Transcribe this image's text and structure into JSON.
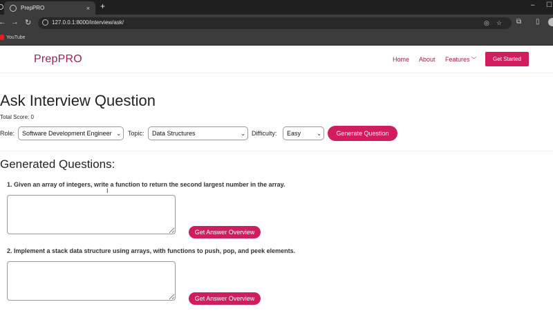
{
  "browser": {
    "tab_title": "PrepPRO",
    "tab_close": "×",
    "new_tab": "+",
    "url": "127.0.0.1:8000/interview/ask/",
    "bookmarks": [
      {
        "label": "YouTube"
      }
    ],
    "window_controls": {
      "minimize": "–",
      "maximize": "☐"
    }
  },
  "header": {
    "brand": "PrepPRO",
    "nav": [
      {
        "label": "Home"
      },
      {
        "label": "About"
      },
      {
        "label": "Features",
        "has_dropdown": true
      }
    ],
    "cta_label": "Get Started"
  },
  "page": {
    "title": "Ask Interview Question",
    "total_score": "Total Score: 0",
    "controls": {
      "role_label": "Role:",
      "role_value": "Software Development Engineer",
      "topic_label": "Topic:",
      "topic_value": "Data Structures",
      "difficulty_label": "Difficulty:",
      "difficulty_value": "Easy",
      "generate_label": "Generate Question"
    },
    "generated_title": "Generated Questions:",
    "questions": [
      {
        "text": "1. Given an array of integers, write a function to return the second largest number in the array.",
        "answer": "",
        "button_label": "Get Answer Overview"
      },
      {
        "text": "2. Implement a stack data structure using arrays, with functions to push, pop, and peek elements.",
        "answer": "",
        "button_label": "Get Answer Overview"
      }
    ]
  },
  "colors": {
    "brand": "#9b1f4f",
    "accent": "#d01d5e",
    "chrome_dark": "#1f1f1f",
    "chrome_toolbar": "#3c3c3c"
  }
}
